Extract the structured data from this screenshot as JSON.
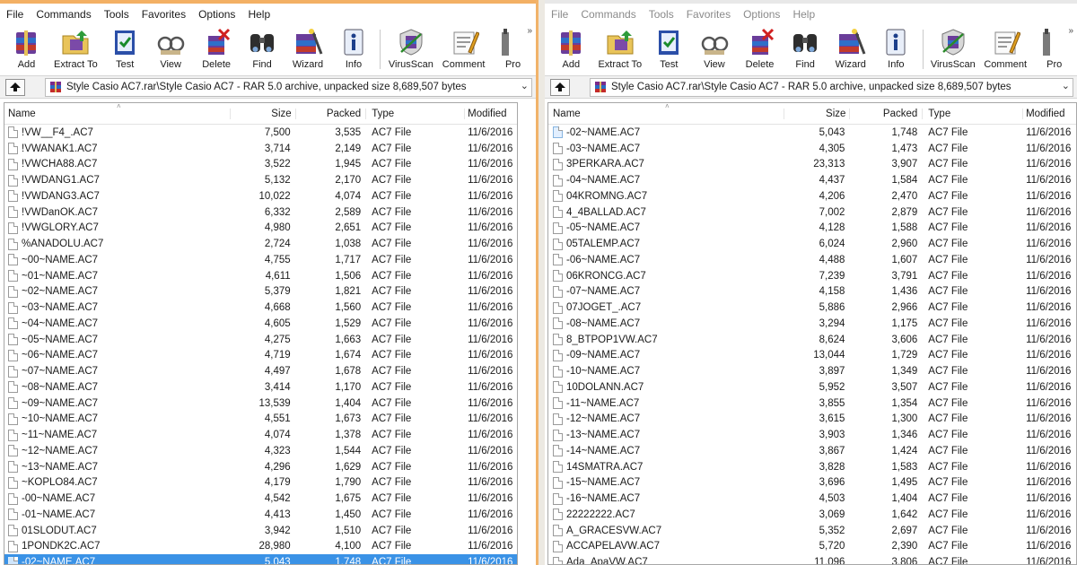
{
  "menu": [
    "File",
    "Commands",
    "Tools",
    "Favorites",
    "Options",
    "Help"
  ],
  "toolbar": [
    "Add",
    "Extract To",
    "Test",
    "View",
    "Delete",
    "Find",
    "Wizard",
    "Info",
    "VirusScan",
    "Comment",
    "Pro"
  ],
  "path": "Style Casio AC7.rar\\Style Casio AC7 - RAR 5.0 archive, unpacked size 8,689,507 bytes",
  "columns": {
    "name": "Name",
    "size": "Size",
    "packed": "Packed",
    "type": "Type",
    "modified": "Modified"
  },
  "left_files": [
    {
      "name": "!VW__F4_.AC7",
      "size": "7,500",
      "packed": "3,535",
      "type": "AC7 File",
      "modified": "11/6/2016"
    },
    {
      "name": "!VWANAK1.AC7",
      "size": "3,714",
      "packed": "2,149",
      "type": "AC7 File",
      "modified": "11/6/2016"
    },
    {
      "name": "!VWCHA88.AC7",
      "size": "3,522",
      "packed": "1,945",
      "type": "AC7 File",
      "modified": "11/6/2016"
    },
    {
      "name": "!VWDANG1.AC7",
      "size": "5,132",
      "packed": "2,170",
      "type": "AC7 File",
      "modified": "11/6/2016"
    },
    {
      "name": "!VWDANG3.AC7",
      "size": "10,022",
      "packed": "4,074",
      "type": "AC7 File",
      "modified": "11/6/2016"
    },
    {
      "name": "!VWDanOK.AC7",
      "size": "6,332",
      "packed": "2,589",
      "type": "AC7 File",
      "modified": "11/6/2016"
    },
    {
      "name": "!VWGLORY.AC7",
      "size": "4,980",
      "packed": "2,651",
      "type": "AC7 File",
      "modified": "11/6/2016"
    },
    {
      "name": "%ANADOLU.AC7",
      "size": "2,724",
      "packed": "1,038",
      "type": "AC7 File",
      "modified": "11/6/2016"
    },
    {
      "name": "~00~NAME.AC7",
      "size": "4,755",
      "packed": "1,717",
      "type": "AC7 File",
      "modified": "11/6/2016"
    },
    {
      "name": "~01~NAME.AC7",
      "size": "4,611",
      "packed": "1,506",
      "type": "AC7 File",
      "modified": "11/6/2016"
    },
    {
      "name": "~02~NAME.AC7",
      "size": "5,379",
      "packed": "1,821",
      "type": "AC7 File",
      "modified": "11/6/2016"
    },
    {
      "name": "~03~NAME.AC7",
      "size": "4,668",
      "packed": "1,560",
      "type": "AC7 File",
      "modified": "11/6/2016"
    },
    {
      "name": "~04~NAME.AC7",
      "size": "4,605",
      "packed": "1,529",
      "type": "AC7 File",
      "modified": "11/6/2016"
    },
    {
      "name": "~05~NAME.AC7",
      "size": "4,275",
      "packed": "1,663",
      "type": "AC7 File",
      "modified": "11/6/2016"
    },
    {
      "name": "~06~NAME.AC7",
      "size": "4,719",
      "packed": "1,674",
      "type": "AC7 File",
      "modified": "11/6/2016"
    },
    {
      "name": "~07~NAME.AC7",
      "size": "4,497",
      "packed": "1,678",
      "type": "AC7 File",
      "modified": "11/6/2016"
    },
    {
      "name": "~08~NAME.AC7",
      "size": "3,414",
      "packed": "1,170",
      "type": "AC7 File",
      "modified": "11/6/2016"
    },
    {
      "name": "~09~NAME.AC7",
      "size": "13,539",
      "packed": "1,404",
      "type": "AC7 File",
      "modified": "11/6/2016"
    },
    {
      "name": "~10~NAME.AC7",
      "size": "4,551",
      "packed": "1,673",
      "type": "AC7 File",
      "modified": "11/6/2016"
    },
    {
      "name": "~11~NAME.AC7",
      "size": "4,074",
      "packed": "1,378",
      "type": "AC7 File",
      "modified": "11/6/2016"
    },
    {
      "name": "~12~NAME.AC7",
      "size": "4,323",
      "packed": "1,544",
      "type": "AC7 File",
      "modified": "11/6/2016"
    },
    {
      "name": "~13~NAME.AC7",
      "size": "4,296",
      "packed": "1,629",
      "type": "AC7 File",
      "modified": "11/6/2016"
    },
    {
      "name": "~KOPLO84.AC7",
      "size": "4,179",
      "packed": "1,790",
      "type": "AC7 File",
      "modified": "11/6/2016"
    },
    {
      "name": "-00~NAME.AC7",
      "size": "4,542",
      "packed": "1,675",
      "type": "AC7 File",
      "modified": "11/6/2016"
    },
    {
      "name": "-01~NAME.AC7",
      "size": "4,413",
      "packed": "1,450",
      "type": "AC7 File",
      "modified": "11/6/2016"
    },
    {
      "name": "01SLODUT.AC7",
      "size": "3,942",
      "packed": "1,510",
      "type": "AC7 File",
      "modified": "11/6/2016"
    },
    {
      "name": "1PONDK2C.AC7",
      "size": "28,980",
      "packed": "4,100",
      "type": "AC7 File",
      "modified": "11/6/2016"
    },
    {
      "name": "-02~NAME.AC7",
      "size": "5,043",
      "packed": "1,748",
      "type": "AC7 File",
      "modified": "11/6/2016",
      "selected": true
    }
  ],
  "right_files": [
    {
      "name": "-02~NAME.AC7",
      "size": "5,043",
      "packed": "1,748",
      "type": "AC7 File",
      "modified": "11/6/2016",
      "selected": true
    },
    {
      "name": "-03~NAME.AC7",
      "size": "4,305",
      "packed": "1,473",
      "type": "AC7 File",
      "modified": "11/6/2016"
    },
    {
      "name": "3PERKARA.AC7",
      "size": "23,313",
      "packed": "3,907",
      "type": "AC7 File",
      "modified": "11/6/2016"
    },
    {
      "name": "-04~NAME.AC7",
      "size": "4,437",
      "packed": "1,584",
      "type": "AC7 File",
      "modified": "11/6/2016"
    },
    {
      "name": "04KROMNG.AC7",
      "size": "4,206",
      "packed": "2,470",
      "type": "AC7 File",
      "modified": "11/6/2016"
    },
    {
      "name": "4_4BALLAD.AC7",
      "size": "7,002",
      "packed": "2,879",
      "type": "AC7 File",
      "modified": "11/6/2016"
    },
    {
      "name": "-05~NAME.AC7",
      "size": "4,128",
      "packed": "1,588",
      "type": "AC7 File",
      "modified": "11/6/2016"
    },
    {
      "name": "05TALEMP.AC7",
      "size": "6,024",
      "packed": "2,960",
      "type": "AC7 File",
      "modified": "11/6/2016"
    },
    {
      "name": "-06~NAME.AC7",
      "size": "4,488",
      "packed": "1,607",
      "type": "AC7 File",
      "modified": "11/6/2016"
    },
    {
      "name": "06KRONCG.AC7",
      "size": "7,239",
      "packed": "3,791",
      "type": "AC7 File",
      "modified": "11/6/2016"
    },
    {
      "name": "-07~NAME.AC7",
      "size": "4,158",
      "packed": "1,436",
      "type": "AC7 File",
      "modified": "11/6/2016"
    },
    {
      "name": "07JOGET_.AC7",
      "size": "5,886",
      "packed": "2,966",
      "type": "AC7 File",
      "modified": "11/6/2016"
    },
    {
      "name": "-08~NAME.AC7",
      "size": "3,294",
      "packed": "1,175",
      "type": "AC7 File",
      "modified": "11/6/2016"
    },
    {
      "name": "8_BTPOP1VW.AC7",
      "size": "8,624",
      "packed": "3,606",
      "type": "AC7 File",
      "modified": "11/6/2016"
    },
    {
      "name": "-09~NAME.AC7",
      "size": "13,044",
      "packed": "1,729",
      "type": "AC7 File",
      "modified": "11/6/2016"
    },
    {
      "name": "-10~NAME.AC7",
      "size": "3,897",
      "packed": "1,349",
      "type": "AC7 File",
      "modified": "11/6/2016"
    },
    {
      "name": "10DOLANN.AC7",
      "size": "5,952",
      "packed": "3,507",
      "type": "AC7 File",
      "modified": "11/6/2016"
    },
    {
      "name": "-11~NAME.AC7",
      "size": "3,855",
      "packed": "1,354",
      "type": "AC7 File",
      "modified": "11/6/2016"
    },
    {
      "name": "-12~NAME.AC7",
      "size": "3,615",
      "packed": "1,300",
      "type": "AC7 File",
      "modified": "11/6/2016"
    },
    {
      "name": "-13~NAME.AC7",
      "size": "3,903",
      "packed": "1,346",
      "type": "AC7 File",
      "modified": "11/6/2016"
    },
    {
      "name": "-14~NAME.AC7",
      "size": "3,867",
      "packed": "1,424",
      "type": "AC7 File",
      "modified": "11/6/2016"
    },
    {
      "name": "14SMATRA.AC7",
      "size": "3,828",
      "packed": "1,583",
      "type": "AC7 File",
      "modified": "11/6/2016"
    },
    {
      "name": "-15~NAME.AC7",
      "size": "3,696",
      "packed": "1,495",
      "type": "AC7 File",
      "modified": "11/6/2016"
    },
    {
      "name": "-16~NAME.AC7",
      "size": "4,503",
      "packed": "1,404",
      "type": "AC7 File",
      "modified": "11/6/2016"
    },
    {
      "name": "22222222.AC7",
      "size": "3,069",
      "packed": "1,642",
      "type": "AC7 File",
      "modified": "11/6/2016"
    },
    {
      "name": "A_GRACESVW.AC7",
      "size": "5,352",
      "packed": "2,697",
      "type": "AC7 File",
      "modified": "11/6/2016"
    },
    {
      "name": "ACCAPELAVW.AC7",
      "size": "5,720",
      "packed": "2,390",
      "type": "AC7 File",
      "modified": "11/6/2016"
    },
    {
      "name": "Ada_ApaVW.AC7",
      "size": "11,096",
      "packed": "3,806",
      "type": "AC7 File",
      "modified": "11/6/2016"
    }
  ]
}
